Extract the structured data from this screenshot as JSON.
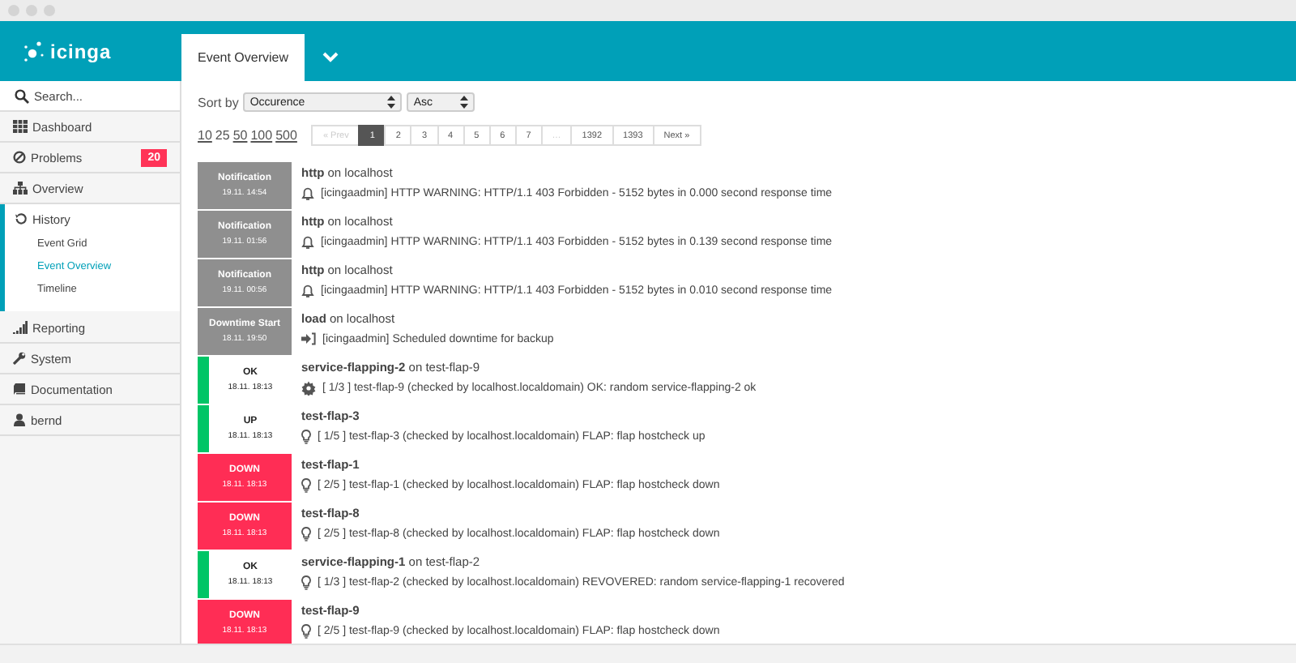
{
  "header": {
    "logo": "icinga"
  },
  "tabs": [
    {
      "label": "Event Overview",
      "selected": true
    }
  ],
  "sidebar": {
    "search": {
      "placeholder": "Search..."
    },
    "items": [
      {
        "label": "Dashboard",
        "kind": "grid",
        "expanded": false
      },
      {
        "label": "Problems",
        "kind": "problem",
        "badge": "20",
        "expanded": false
      },
      {
        "label": "Overview",
        "kind": "tree",
        "expanded": false
      },
      {
        "label": "History",
        "kind": "history",
        "expanded": true,
        "children": [
          {
            "label": "Event Grid",
            "selected": false
          },
          {
            "label": "Event Overview",
            "selected": true
          },
          {
            "label": "Timeline",
            "selected": false
          }
        ]
      },
      {
        "label": "Reporting",
        "kind": "bars",
        "expanded": false
      },
      {
        "label": "System",
        "kind": "wrench",
        "expanded": false
      },
      {
        "label": "Documentation",
        "kind": "book",
        "expanded": false
      },
      {
        "label": "bernd",
        "kind": "user",
        "expanded": false
      }
    ]
  },
  "sort": {
    "label": "Sort by",
    "field": "Occurence",
    "order": "Asc"
  },
  "page_sizes": [
    {
      "label": "10",
      "selected": false
    },
    {
      "label": "25",
      "selected": true
    },
    {
      "label": "50",
      "selected": false
    },
    {
      "label": "100",
      "selected": false
    },
    {
      "label": "500",
      "selected": false
    }
  ],
  "pagination": [
    {
      "label": "« Prev",
      "selected": false,
      "disabled": true
    },
    {
      "label": "1",
      "selected": true,
      "disabled": false
    },
    {
      "label": "2",
      "selected": false,
      "disabled": false
    },
    {
      "label": "3",
      "selected": false,
      "disabled": false
    },
    {
      "label": "4",
      "selected": false,
      "disabled": false
    },
    {
      "label": "5",
      "selected": false,
      "disabled": false
    },
    {
      "label": "6",
      "selected": false,
      "disabled": false
    },
    {
      "label": "7",
      "selected": false,
      "disabled": false
    },
    {
      "label": "…",
      "selected": false,
      "disabled": true
    },
    {
      "label": "1392",
      "selected": false,
      "disabled": false
    },
    {
      "label": "1393",
      "selected": false,
      "disabled": false
    },
    {
      "label": "Next »",
      "selected": false,
      "disabled": false
    }
  ],
  "events": [
    {
      "kind": "notification",
      "state": "Notification",
      "time": "19.11. 14:54",
      "title": "**http** on localhost",
      "message": "[icingaadmin] HTTP WARNING: HTTP/1.1 403 Forbidden - 5152 bytes in 0.000 second response time"
    },
    {
      "kind": "notification",
      "state": "Notification",
      "time": "19.11. 01:56",
      "title": "**http** on localhost",
      "message": "[icingaadmin] HTTP WARNING: HTTP/1.1 403 Forbidden - 5152 bytes in 0.139 second response time"
    },
    {
      "kind": "notification",
      "state": "Notification",
      "time": "19.11. 00:56",
      "title": "**http** on localhost",
      "message": "[icingaadmin] HTTP WARNING: HTTP/1.1 403 Forbidden - 5152 bytes in 0.010 second response time"
    },
    {
      "kind": "downtime",
      "state": "Downtime Start",
      "time": "18.11. 19:50",
      "title": "**load** on localhost",
      "message": "[icingaadmin] Scheduled downtime for backup"
    },
    {
      "kind": "service_ok",
      "state": "OK",
      "time": "18.11. 18:13",
      "title": "**service-flapping-2** on test-flap-9",
      "message": "[ 1/3 ] test-flap-9 (checked by localhost.localdomain) OK: random service-flapping-2 ok"
    },
    {
      "kind": "flap_up",
      "state": "UP",
      "time": "18.11. 18:13",
      "title": "**test-flap-3**",
      "message": "[ 1/5 ] test-flap-3 (checked by localhost.localdomain) FLAP: flap hostcheck up"
    },
    {
      "kind": "flap_down",
      "state": "DOWN",
      "time": "18.11. 18:13",
      "title": "**test-flap-1**",
      "message": "[ 2/5 ] test-flap-1 (checked by localhost.localdomain) FLAP: flap hostcheck down"
    },
    {
      "kind": "flap_down",
      "state": "DOWN",
      "time": "18.11. 18:13",
      "title": "**test-flap-8**",
      "message": "[ 2/5 ] test-flap-8 (checked by localhost.localdomain) FLAP: flap hostcheck down"
    },
    {
      "kind": "recovered",
      "state": "OK",
      "time": "18.11. 18:13",
      "title": "**service-flapping-1** on test-flap-2",
      "message": "[ 1/3 ] test-flap-2 (checked by localhost.localdomain) REVOVERED: random service-flapping-1 recovered"
    },
    {
      "kind": "flap_down",
      "state": "DOWN",
      "time": "18.11. 18:13",
      "title": "**test-flap-9**",
      "message": "[ 2/5 ] test-flap-9 (checked by localhost.localdomain) FLAP: flap hostcheck down"
    }
  ]
}
